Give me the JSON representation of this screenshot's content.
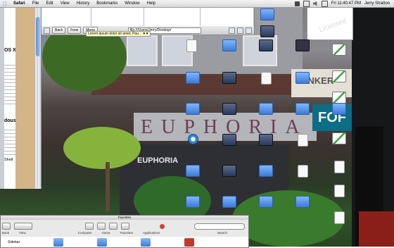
{
  "menubar": {
    "app_name": "Safari",
    "items": [
      "File",
      "Edit",
      "View",
      "History",
      "Bookmarks",
      "Window",
      "Help"
    ],
    "clock": "Fri 11:40:47 PM",
    "user": "Jerry Stratton"
  },
  "safari_doc": {
    "line1": "OS X",
    "line2": "dous",
    "line3": "Shell"
  },
  "finder_toolbar": {
    "back": "Back",
    "forward": "Forw",
    "menu": "Menu",
    "address": "file:///Users/Jerry/Desktop/"
  },
  "tooltip": "Lorem ipsum dolor sit amet, Pau… ♥ ♥",
  "small_window": {
    "watermark": "Licensed"
  },
  "desktop_icons": [
    {
      "label": "",
      "type": "folder"
    },
    {
      "label": "",
      "type": "app"
    },
    {
      "label": "",
      "type": "chart"
    },
    {
      "label": "",
      "type": "doc"
    },
    {
      "label": "",
      "type": "folder"
    },
    {
      "label": "",
      "type": "app"
    },
    {
      "label": "",
      "type": "gear"
    },
    {
      "label": "",
      "type": "chart"
    },
    {
      "label": "",
      "type": "folder"
    },
    {
      "label": "",
      "type": "app"
    },
    {
      "label": "",
      "type": "doc"
    },
    {
      "label": "",
      "type": "folder"
    },
    {
      "label": "",
      "type": "chart"
    },
    {
      "label": "",
      "type": "folder"
    },
    {
      "label": "",
      "type": "app"
    },
    {
      "label": "",
      "type": "folder"
    },
    {
      "label": "",
      "type": "folder"
    },
    {
      "label": "",
      "type": "folder"
    },
    {
      "label": "",
      "type": "chart"
    },
    {
      "label": "",
      "type": "disc"
    },
    {
      "label": "",
      "type": "app"
    },
    {
      "label": "",
      "type": "app"
    },
    {
      "label": "",
      "type": "doc"
    },
    {
      "label": "",
      "type": "doc"
    },
    {
      "label": "",
      "type": "folder"
    },
    {
      "label": "",
      "type": "app"
    },
    {
      "label": "",
      "type": "folder"
    },
    {
      "label": "",
      "type": "doc"
    },
    {
      "label": "",
      "type": "doc"
    },
    {
      "label": "",
      "type": "folder"
    },
    {
      "label": "",
      "type": "folder"
    },
    {
      "label": "",
      "type": "folder"
    },
    {
      "label": "",
      "type": "folder"
    },
    {
      "label": "",
      "type": "doc"
    }
  ],
  "finder_bottom": {
    "title": "Favorites",
    "sidebar_item": "Sidebar",
    "toolbar_labels": [
      "Back",
      "View",
      "Computer",
      "Home",
      "Favorites",
      "Applications",
      "Search"
    ]
  },
  "storefront": {
    "name": "EUPHORIA"
  },
  "signs": {
    "euphoria": "EUPHORIA",
    "bank": "ANKER",
    "fof": "FOF"
  }
}
